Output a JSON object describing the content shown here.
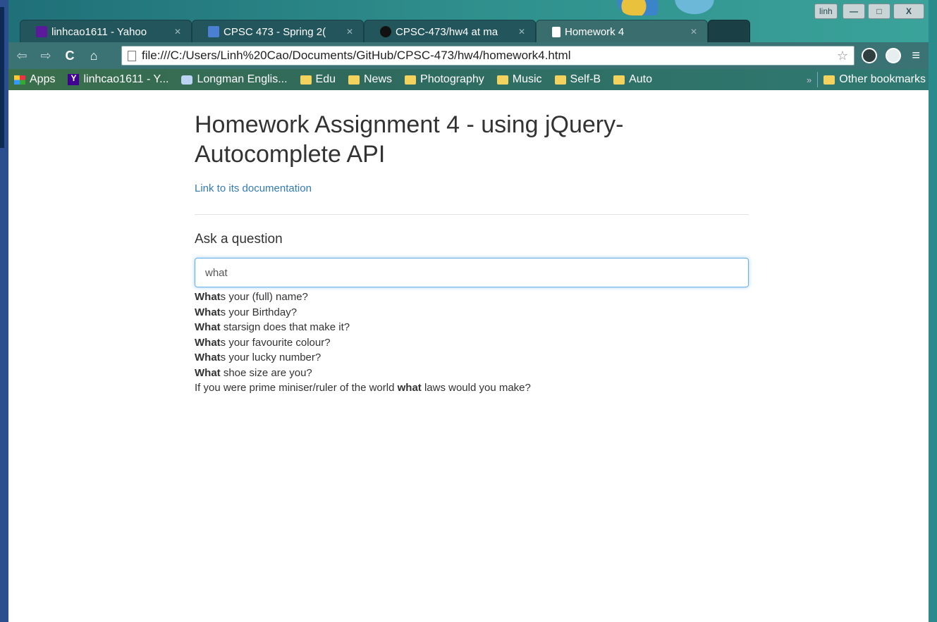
{
  "browser": {
    "tabs": [
      {
        "label": "linhcao1611 - Yahoo",
        "favicon": "yahoo-mail-icon",
        "state": "inactive"
      },
      {
        "label": "CPSC 473 - Spring 2(",
        "favicon": "google-docs-icon",
        "state": "inactive"
      },
      {
        "label": "CPSC-473/hw4 at ma",
        "favicon": "github-icon",
        "state": "inactive"
      },
      {
        "label": "Homework 4",
        "favicon": "page-icon",
        "state": "active"
      }
    ],
    "user_badge": "linh",
    "window_controls": {
      "minimize": "—",
      "maximize": "□",
      "close": "X"
    },
    "url": "file:///C:/Users/Linh%20Cao/Documents/GitHub/CPSC-473/hw4/homework4.html",
    "nav_icons": [
      "back-arrow-icon",
      "forward-arrow-icon",
      "reload-icon",
      "home-icon"
    ],
    "bookmarks": [
      {
        "label": "Apps",
        "icon": "apps-grid-icon"
      },
      {
        "label": "linhcao1611 - Y...",
        "icon": "yahoo-icon"
      },
      {
        "label": "Longman Englis...",
        "icon": "longman-icon"
      },
      {
        "label": "Edu",
        "icon": "folder-icon"
      },
      {
        "label": "News",
        "icon": "folder-icon"
      },
      {
        "label": "Photography",
        "icon": "folder-icon"
      },
      {
        "label": "Music",
        "icon": "folder-icon"
      },
      {
        "label": "Self-B",
        "icon": "folder-icon"
      },
      {
        "label": "Auto",
        "icon": "folder-icon"
      }
    ],
    "other_bookmarks": "Other bookmarks",
    "overflow_chevron": "»"
  },
  "page": {
    "title": "Homework Assignment 4 - using jQuery-Autocomplete API",
    "doc_link": "Link to its documentation",
    "section_heading": "Ask a question",
    "search": {
      "value": "what"
    },
    "suggestions": [
      {
        "match": "What",
        "rest": "s your (full) name?"
      },
      {
        "match": "What",
        "rest": "s your Birthday?"
      },
      {
        "match": "What",
        "rest": " starsign does that make it?"
      },
      {
        "match": "What",
        "rest": "s your favourite colour?"
      },
      {
        "match": "What",
        "rest": "s your lucky number?"
      },
      {
        "match": "What",
        "rest": " shoe size are you?"
      },
      {
        "before": "If you were prime miniser/ruler of the world ",
        "match": "what",
        "rest": " laws would you make?"
      }
    ]
  },
  "colors": {
    "link": "#337ab7",
    "focus_border": "#66afe9",
    "toolbar": "#3b7274"
  }
}
